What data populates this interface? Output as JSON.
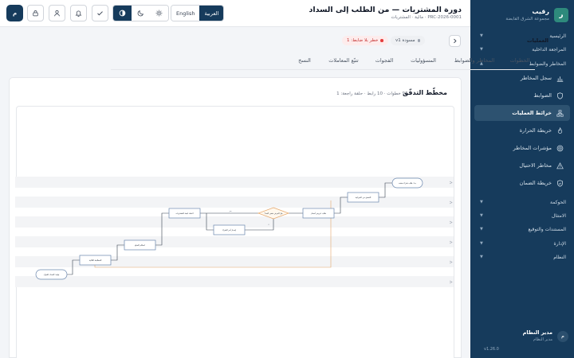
{
  "brand": {
    "logo_letter": "ر",
    "name": "رقيب",
    "subtitle": "مجموعة الشرق القابضة"
  },
  "sidebar": {
    "groups": [
      {
        "label": "الرئيسية"
      },
      {
        "label": "المراجعة الداخلية"
      },
      {
        "label": "المخاطر والضوابط"
      },
      {
        "label": "الحوكمة"
      },
      {
        "label": "الامتثال"
      },
      {
        "label": "المستندات والتوقيع"
      },
      {
        "label": "الإدارة"
      },
      {
        "label": "النظام"
      }
    ],
    "items": [
      {
        "label": "سجل المخاطر",
        "icon": "bar-chart-icon"
      },
      {
        "label": "الضوابط",
        "icon": "shield-icon"
      },
      {
        "label": "خرائط العمليات",
        "icon": "process-map-icon",
        "active": true
      },
      {
        "label": "خريطة الحرارة",
        "icon": "flame-icon"
      },
      {
        "label": "مؤشرات المخاطر",
        "icon": "gauge-icon"
      },
      {
        "label": "مخاطر الاحتيال",
        "icon": "alert-icon"
      },
      {
        "label": "خريطة الضمان",
        "icon": "shield-check-icon"
      }
    ]
  },
  "user": {
    "avatar_letter": "م",
    "name": "مدير النظام",
    "role": "مدير النظام"
  },
  "app_version": "v1.26.0",
  "header": {
    "title": "دورة المشتريات — من الطلب إلى السداد",
    "subtitle": "PRC-2026-0001 · مالية · المشتريات",
    "lang_ar": "العربية",
    "lang_en": "English",
    "avatar_letter": "م"
  },
  "breadcrumb": {
    "label": "العمليات"
  },
  "status_badge": {
    "text": "مسودة v1",
    "color": "#9ca3af"
  },
  "risk_badge": {
    "text": "خطر بلا ضابط: 1",
    "color": "#e53e3e"
  },
  "tabs": [
    {
      "label": "المخطط",
      "active": true
    },
    {
      "label": "الخطوات"
    },
    {
      "label": "المخاطر والضوابط"
    },
    {
      "label": "المسؤوليات"
    },
    {
      "label": "الفجوات"
    },
    {
      "label": "تتبّع المعاملات"
    },
    {
      "label": "النسخ"
    }
  ],
  "card": {
    "title": "مخطّط التدفّق",
    "meta": "9 خطوات · 10 رابط · حلقة راجعة: 1"
  },
  "flow": {
    "nodes": [
      {
        "label": "بدء: طلب شراء معتمد"
      },
      {
        "label": "التحقق من الميزانية"
      },
      {
        "label": "طلب عروض أسعار"
      },
      {
        "label": "هل العرض ضمن الحد؟"
      },
      {
        "label": "إصدار أمر الشراء"
      },
      {
        "label": "اعتماد لجنة المشتريات"
      },
      {
        "label": "استلام السلع"
      },
      {
        "label": "المطابقة الثلاثية"
      },
      {
        "label": "نهاية: السداد للمورّد"
      }
    ],
    "edge_labels": [
      {
        "label": "نعم"
      },
      {
        "label": "لا"
      }
    ]
  }
}
